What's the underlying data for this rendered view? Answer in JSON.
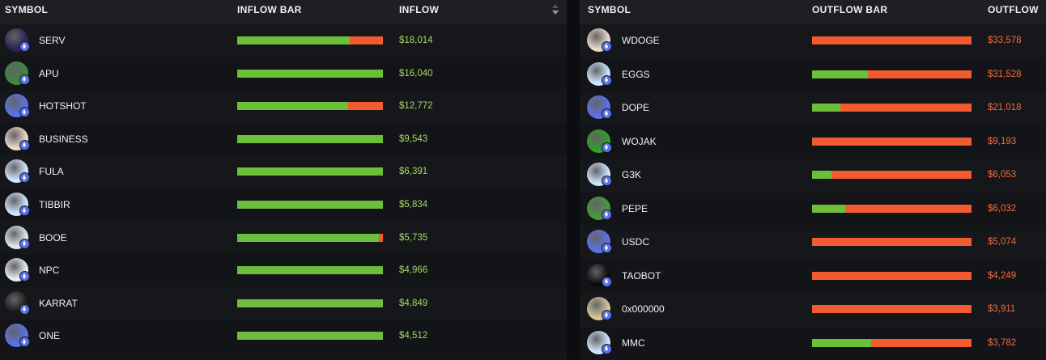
{
  "inflow": {
    "headers": {
      "symbol": "SYMBOL",
      "bar": "INFLOW BAR",
      "value": "INFLOW"
    },
    "sort_icon": "sort-arrows-icon",
    "rows": [
      {
        "symbol": "SERV",
        "value": "$18,014",
        "inflow_share": 0.77,
        "icon": "serv-token-icon",
        "color": "#2a2358"
      },
      {
        "symbol": "APU",
        "value": "$16,040",
        "inflow_share": 1.0,
        "icon": "apu-token-icon",
        "color": "#3d8a3a"
      },
      {
        "symbol": "HOTSHOT",
        "value": "$12,772",
        "inflow_share": 0.76,
        "icon": "eth-token-icon",
        "color": "#5a72e8"
      },
      {
        "symbol": "BUSINESS",
        "value": "$9,543",
        "inflow_share": 1.0,
        "icon": "business-token-icon",
        "color": "#e8d9cc"
      },
      {
        "symbol": "FULA",
        "value": "$6,391",
        "inflow_share": 1.0,
        "icon": "fula-token-icon",
        "color": "#cfe6ff"
      },
      {
        "symbol": "TIBBIR",
        "value": "$5,834",
        "inflow_share": 1.0,
        "icon": "tibbir-token-icon",
        "color": "#cfe6ff"
      },
      {
        "symbol": "BOOE",
        "value": "$5,735",
        "inflow_share": 0.97,
        "icon": "booe-token-icon",
        "color": "#dfe8f5"
      },
      {
        "symbol": "NPC",
        "value": "$4,966",
        "inflow_share": 1.0,
        "icon": "npc-token-icon",
        "color": "#e8eef2"
      },
      {
        "symbol": "KARRAT",
        "value": "$4,849",
        "inflow_share": 1.0,
        "icon": "karrat-token-icon",
        "color": "#1a1a1a"
      },
      {
        "symbol": "ONE",
        "value": "$4,512",
        "inflow_share": 1.0,
        "icon": "eth-token-icon",
        "color": "#5a72e8"
      }
    ]
  },
  "outflow": {
    "headers": {
      "symbol": "SYMBOL",
      "bar": "OUTFLOW BAR",
      "value": "OUTFLOW"
    },
    "rows": [
      {
        "symbol": "WDOGE",
        "value": "$33,578",
        "inflow_share": 0.0,
        "icon": "wdoge-token-icon",
        "color": "#e8d9cc"
      },
      {
        "symbol": "EGGS",
        "value": "$31,528",
        "inflow_share": 0.35,
        "icon": "eggs-token-icon",
        "color": "#cfe6ff"
      },
      {
        "symbol": "DOPE",
        "value": "$21,018",
        "inflow_share": 0.18,
        "icon": "eth-token-icon",
        "color": "#5a72e8"
      },
      {
        "symbol": "WOJAK",
        "value": "$9,193",
        "inflow_share": 0.0,
        "icon": "wojak-token-icon",
        "color": "#2fa02a"
      },
      {
        "symbol": "G3K",
        "value": "$6,053",
        "inflow_share": 0.12,
        "icon": "g3k-token-icon",
        "color": "#cfe6ff"
      },
      {
        "symbol": "PEPE",
        "value": "$6,032",
        "inflow_share": 0.21,
        "icon": "pepe-token-icon",
        "color": "#4a9a3a"
      },
      {
        "symbol": "USDC",
        "value": "$5,074",
        "inflow_share": 0.0,
        "icon": "eth-token-icon",
        "color": "#5a72e8"
      },
      {
        "symbol": "TAOBOT",
        "value": "$4,249",
        "inflow_share": 0.0,
        "icon": "taobot-token-icon",
        "color": "#0a0a0a"
      },
      {
        "symbol": "0x000000",
        "value": "$3,911",
        "inflow_share": 0.0,
        "icon": "wheat-token-icon",
        "color": "#d9c79a"
      },
      {
        "symbol": "MMC",
        "value": "$3,782",
        "inflow_share": 0.37,
        "icon": "mmc-token-icon",
        "color": "#cfe6ff"
      }
    ]
  },
  "colors": {
    "inflow_bar": "#6cbf3a",
    "outflow_bar": "#f25a30",
    "inflow_text": "#a5d86a",
    "outflow_text": "#f4693f"
  }
}
